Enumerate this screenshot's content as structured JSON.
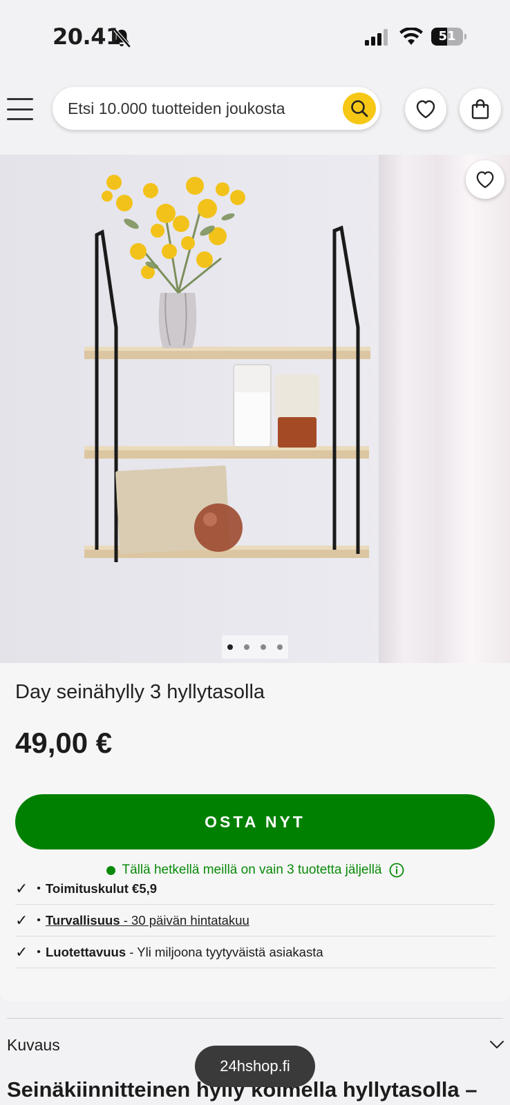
{
  "status_bar": {
    "time": "20.41",
    "battery_level": "51",
    "battery_fraction": 0.51
  },
  "header": {
    "search_placeholder": "Etsi 10.000 tuotteiden joukosta",
    "icons": [
      "menu-icon",
      "search-icon",
      "heart-icon",
      "bag-icon"
    ],
    "accent_color": "#f6c815"
  },
  "gallery": {
    "image_count": 4,
    "active_index": 0
  },
  "product": {
    "title": "Day seinähylly 3 hyllytasolla",
    "price": "49,00 €",
    "buy_label": "OSTA NYT",
    "buy_color": "#008000",
    "stock_text": "Tällä hetkellä meillä on vain 3 tuotetta jäljellä",
    "usps": [
      {
        "check": "✓",
        "bold": "Toimituskulut €5,9",
        "rest": ""
      },
      {
        "check": "✓",
        "bold": "Turvallisuus",
        "rest": " - 30 päivän hintatakuu"
      },
      {
        "check": "✓",
        "bold": "Luotettavuus",
        "rest": " - Yli miljoona tyytyväistä asiakasta"
      }
    ]
  },
  "description": {
    "section_label": "Kuvaus",
    "heading": "Seinäkiinnitteinen hylly kolmella hyllytasolla –"
  },
  "toast": {
    "text": "24hshop.fi"
  }
}
